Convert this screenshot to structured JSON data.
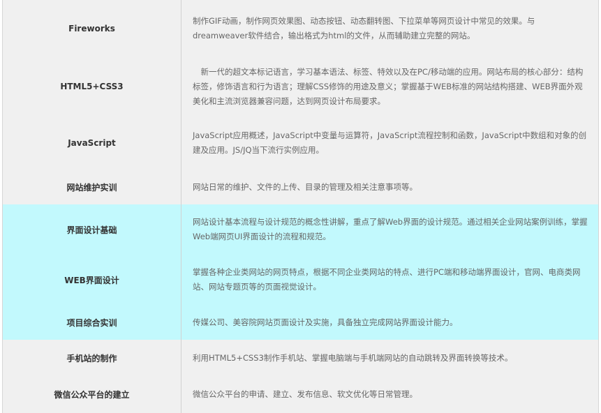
{
  "rows": [
    {
      "course": "Fireworks",
      "description": "制作GIF动画，制作网页效果图、动态按钮、动态翻转图、下拉菜单等网页设计中常见的效果。与dreamweaver软件结合，输出格式为html的文件，从而辅助建立完整的网站。",
      "background": "#f0f0f0"
    },
    {
      "course": "HTML5+CSS3",
      "description": "　新一代的超文本标记语言，学习基本语法、标签、特效以及在PC/移动端的应用。网站布局的核心部分：结构标签，修饰语言和行为语言；理解CSS修饰的用途及意义；掌握基于WEB标准的网站结构搭建、WEB界面外观美化和主流浏览器兼容问题，达到网页设计布局要求。",
      "background": "#f0f0f0"
    },
    {
      "course": "JavaScript",
      "description": "JavaScript应用概述，JavaScript中变量与运算符，JavaScript流程控制和函数，JavaScript中数组和对象的创建及应用。JS/JQ当下流行实例应用。",
      "background": "#f0f0f0"
    },
    {
      "course": "网站维护实训",
      "description": "网站日常的维护、文件的上传、目录的管理及相关注意事项等。",
      "background": "#f0f0f0"
    },
    {
      "course": "界面设计基础",
      "description": "网站设计基本流程与设计规范的概念性讲解，重点了解Web界面的设计规范。通过相关企业网站案例训练，掌握Web端网页UI界面设计的流程和规范。",
      "background": "#c2f9fd"
    },
    {
      "course": "WEB界面设计",
      "description": "掌握各种企业类网站的网页特点，根据不同企业类网站的特点、进行PC端和移动端界面设计，官网、电商类网站、网站专题页等的页面视觉设计。",
      "background": "#c2f9fd"
    },
    {
      "course": "项目综合实训",
      "description": "传媒公司、美容院网站页面设计及实施，具备独立完成网站界面设计能力。",
      "background": "#c2f9fd"
    },
    {
      "course": "手机站的制作",
      "description": "利用HTML5+CSS3制作手机站、掌握电脑端与手机端网站的自动跳转及界面转换等技术。",
      "background": "#f0f0f0"
    },
    {
      "course": "微信公众平台的建立",
      "description": "微信公众平台的申请、建立、发布信息、软文优化等日常管理。",
      "background": "#f0f0f0"
    }
  ]
}
